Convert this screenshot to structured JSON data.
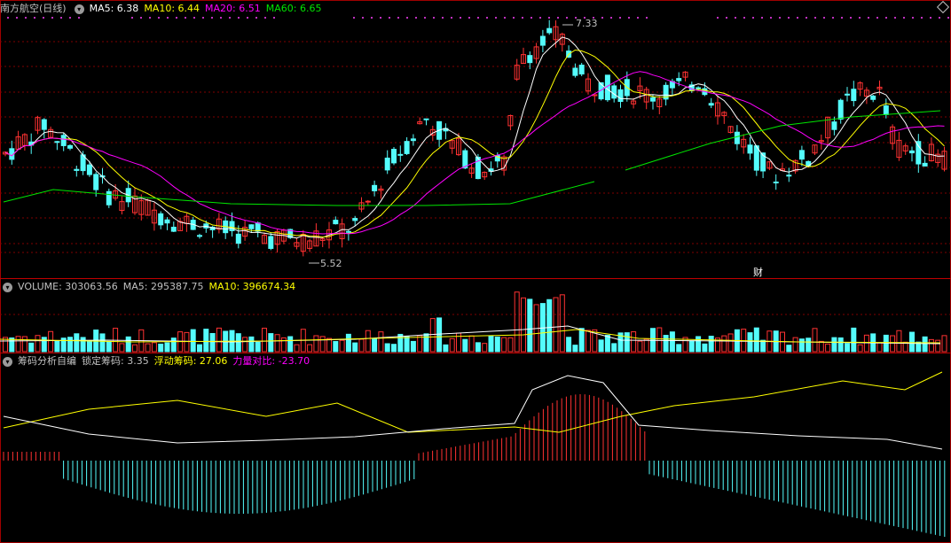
{
  "stock": {
    "name": "南方航空",
    "period": "(日线)"
  },
  "colors": {
    "up": "#ff3232",
    "down": "#54fcfc",
    "ma5": "#ffffff",
    "ma10": "#ffff00",
    "ma20": "#ff00ff",
    "ma60": "#00e600",
    "grid": "#800000",
    "label": "#c0c0c0"
  },
  "main_legend": {
    "ma5": "MA5: 6.38",
    "ma10": "MA10: 6.44",
    "ma20": "MA20: 6.51",
    "ma60": "MA60: 6.65"
  },
  "main_annotations": {
    "high": "7.33",
    "low": "5.52",
    "finance_badge": "财"
  },
  "volume_legend": {
    "volume": "VOLUME: 303063.56",
    "ma5": "MA5: 295387.75",
    "ma10": "MA10: 396674.34"
  },
  "chip_legend": {
    "title": "筹码分析自编",
    "locked": "锁定筹码: 3.35",
    "floating": "浮动筹码: 27.06",
    "ratio": "力量对比: -23.70"
  },
  "icons": {
    "legend_menu": "chevron-down-icon",
    "corner": "diamond-icon"
  },
  "chart_data": {
    "type": "candlestick",
    "panels": [
      "price",
      "volume",
      "chip_indicator"
    ],
    "price_range": [
      5.3,
      7.5
    ],
    "annotated_high": 7.33,
    "annotated_low": 5.52,
    "last_values": {
      "ma5": 6.38,
      "ma10": 6.44,
      "ma20": 6.51,
      "ma60": 6.65
    },
    "volume_last": {
      "volume": 303063.56,
      "ma5": 295387.75,
      "ma10": 396674.34
    },
    "chip_last": {
      "locked": 3.35,
      "floating": 27.06,
      "ratio": -23.7
    }
  }
}
